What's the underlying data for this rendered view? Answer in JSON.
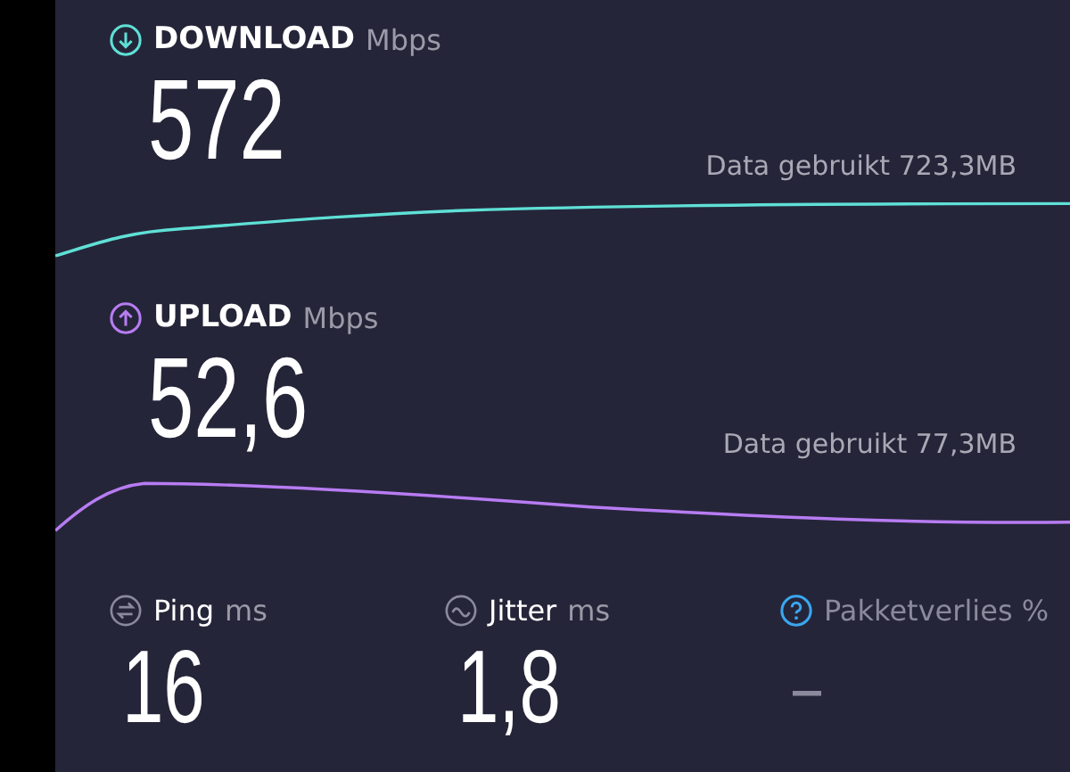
{
  "speeds": [
    {
      "kind": "download",
      "label": "DOWNLOAD",
      "unit": "Mbps",
      "value": "572",
      "data_used": "Data gebruikt 723,3MB"
    },
    {
      "kind": "upload",
      "label": "UPLOAD",
      "unit": "Mbps",
      "value": "52,6",
      "data_used": "Data gebruikt 77,3MB"
    }
  ],
  "metrics": [
    {
      "kind": "ping",
      "label": "Ping",
      "unit": "ms",
      "value": "16"
    },
    {
      "kind": "jitter",
      "label": "Jitter",
      "unit": "ms",
      "value": "1,8"
    },
    {
      "kind": "packet_loss",
      "label": "Pakketverlies %",
      "value": "–"
    }
  ]
}
